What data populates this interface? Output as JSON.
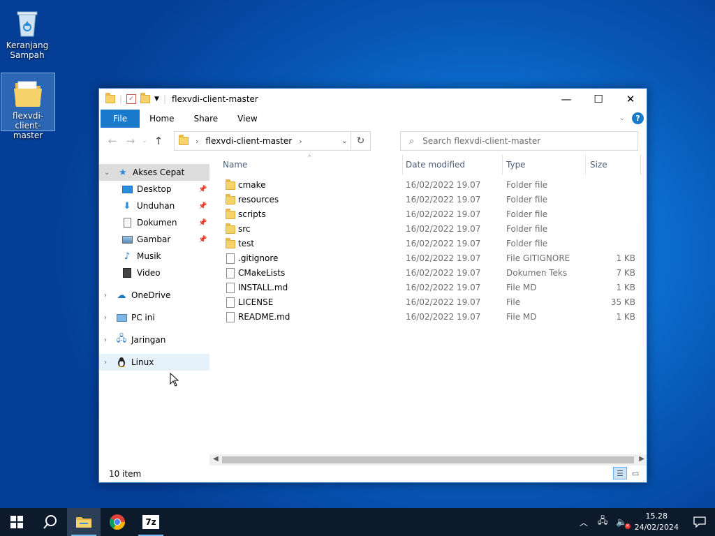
{
  "desktop": {
    "icons": [
      {
        "label": "Keranjang Sampah",
        "icon": "recycle-bin-icon"
      },
      {
        "label": "flexvdi-client-master",
        "icon": "folder-icon"
      }
    ]
  },
  "window": {
    "title": "flexvdi-client-master",
    "ribbon_tabs": [
      "File",
      "Home",
      "Share",
      "View"
    ],
    "breadcrumb": "flexvdi-client-master",
    "search_placeholder": "Search flexvdi-client-master",
    "columns": [
      "Name",
      "Date modified",
      "Type",
      "Size"
    ],
    "files": [
      {
        "name": "cmake",
        "date": "16/02/2022 19.07",
        "type": "Folder file",
        "size": "",
        "kind": "folder"
      },
      {
        "name": "resources",
        "date": "16/02/2022 19.07",
        "type": "Folder file",
        "size": "",
        "kind": "folder"
      },
      {
        "name": "scripts",
        "date": "16/02/2022 19.07",
        "type": "Folder file",
        "size": "",
        "kind": "folder"
      },
      {
        "name": "src",
        "date": "16/02/2022 19.07",
        "type": "Folder file",
        "size": "",
        "kind": "folder"
      },
      {
        "name": "test",
        "date": "16/02/2022 19.07",
        "type": "Folder file",
        "size": "",
        "kind": "folder"
      },
      {
        "name": ".gitignore",
        "date": "16/02/2022 19.07",
        "type": "File GITIGNORE",
        "size": "1 KB",
        "kind": "file"
      },
      {
        "name": "CMakeLists",
        "date": "16/02/2022 19.07",
        "type": "Dokumen Teks",
        "size": "7 KB",
        "kind": "file"
      },
      {
        "name": "INSTALL.md",
        "date": "16/02/2022 19.07",
        "type": "File MD",
        "size": "1 KB",
        "kind": "file"
      },
      {
        "name": "LICENSE",
        "date": "16/02/2022 19.07",
        "type": "File",
        "size": "35 KB",
        "kind": "file"
      },
      {
        "name": "README.md",
        "date": "16/02/2022 19.07",
        "type": "File MD",
        "size": "1 KB",
        "kind": "file"
      }
    ],
    "nav": {
      "quick_access": "Akses Cepat",
      "pinned": [
        {
          "label": "Desktop",
          "icon": "desktop-icon",
          "pinned": true
        },
        {
          "label": "Unduhan",
          "icon": "download-icon",
          "pinned": true
        },
        {
          "label": "Dokumen",
          "icon": "document-icon",
          "pinned": true
        },
        {
          "label": "Gambar",
          "icon": "picture-icon",
          "pinned": true
        },
        {
          "label": "Musik",
          "icon": "music-icon",
          "pinned": false
        },
        {
          "label": "Video",
          "icon": "video-icon",
          "pinned": false
        }
      ],
      "roots": [
        {
          "label": "OneDrive",
          "icon": "cloud-icon"
        },
        {
          "label": "PC ini",
          "icon": "computer-icon"
        },
        {
          "label": "Jaringan",
          "icon": "network-icon"
        },
        {
          "label": "Linux",
          "icon": "linux-icon"
        }
      ]
    },
    "status": "10 item"
  },
  "taskbar": {
    "time": "15.28",
    "date": "24/02/2024"
  },
  "colors": {
    "accent": "#1979ca",
    "taskbar": "#0c1a2c"
  }
}
